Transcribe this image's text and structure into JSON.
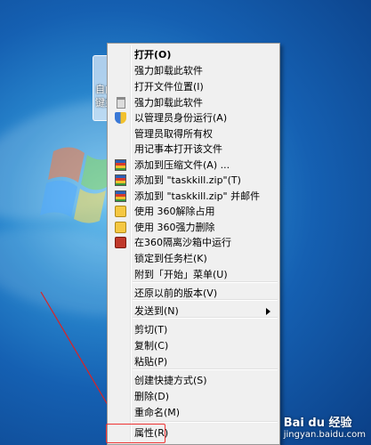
{
  "desktop": {
    "shortcut_label": "自由\n键盘",
    "watermark": {
      "main": "Bai du 经验",
      "sub": "jingyan.baidu.com"
    }
  },
  "menu": {
    "items": [
      {
        "label": "打开(O)",
        "bold": true
      },
      {
        "label": "强力卸载此软件"
      },
      {
        "label": "打开文件位置(I)"
      },
      {
        "label": "强力卸载此软件",
        "icon": "recycle-bin-icon"
      },
      {
        "label": "以管理员身份运行(A)",
        "icon": "uac-shield-icon"
      },
      {
        "label": "管理员取得所有权"
      },
      {
        "label": "用记事本打开该文件"
      },
      {
        "label": "添加到压缩文件(A) ...",
        "icon": "winrar-icon"
      },
      {
        "label": "添加到 \"taskkill.zip\"(T)",
        "icon": "winrar-icon"
      },
      {
        "label": "添加到 \"taskkill.zip\" 并邮件",
        "icon": "winrar-icon"
      },
      {
        "label": "使用 360解除占用",
        "icon": "360-unlock-icon"
      },
      {
        "label": "使用 360强力删除",
        "icon": "360-delete-icon"
      },
      {
        "label": "在360隔离沙箱中运行",
        "icon": "360-sandbox-icon"
      },
      {
        "label": "锁定到任务栏(K)"
      },
      {
        "label": "附到「开始」菜单(U)"
      },
      {
        "label": "还原以前的版本(V)"
      },
      {
        "label": "发送到(N)",
        "submenu": true
      },
      {
        "label": "剪切(T)"
      },
      {
        "label": "复制(C)"
      },
      {
        "label": "粘贴(P)"
      },
      {
        "label": "创建快捷方式(S)"
      },
      {
        "label": "删除(D)"
      },
      {
        "label": "重命名(M)"
      },
      {
        "label": "属性(R)",
        "highlighted": true
      }
    ]
  }
}
